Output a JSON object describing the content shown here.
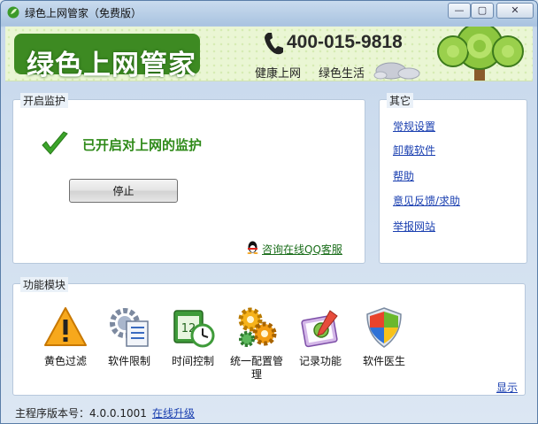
{
  "window": {
    "title": "绿色上网管家（免费版）",
    "controls": {
      "minimize": "—",
      "maximize": "▢",
      "close": "✕"
    }
  },
  "banner": {
    "brand": "绿色上网管家",
    "phone": "400-015-9818",
    "slogan_left": "健康上网",
    "slogan_right": "绿色生活"
  },
  "monitor": {
    "title": "开启监护",
    "status": "已开启对上网的监护",
    "stop_button": "停止",
    "qq_link": "咨询在线QQ客服"
  },
  "other": {
    "title": "其它",
    "links": [
      "常规设置",
      "卸载软件",
      "帮助",
      "意见反馈/求助",
      "举报网站"
    ]
  },
  "modules": {
    "title": "功能模块",
    "items": [
      {
        "label": "黄色过滤",
        "icon": "warning-icon"
      },
      {
        "label": "软件限制",
        "icon": "software-settings-icon"
      },
      {
        "label": "时间控制",
        "icon": "calendar-clock-icon"
      },
      {
        "label": "统一配置管理",
        "icon": "gears-icon"
      },
      {
        "label": "记录功能",
        "icon": "record-clipboard-icon"
      },
      {
        "label": "软件医生",
        "icon": "shield-icon"
      }
    ],
    "show_link": "显示"
  },
  "footer": {
    "version_text": "主程序版本号：4.0.0.1001",
    "update_link": "在线升级"
  },
  "colors": {
    "accent_green": "#2f8a19",
    "link_blue": "#1a3fb0",
    "brand_green": "#3d8a22"
  }
}
